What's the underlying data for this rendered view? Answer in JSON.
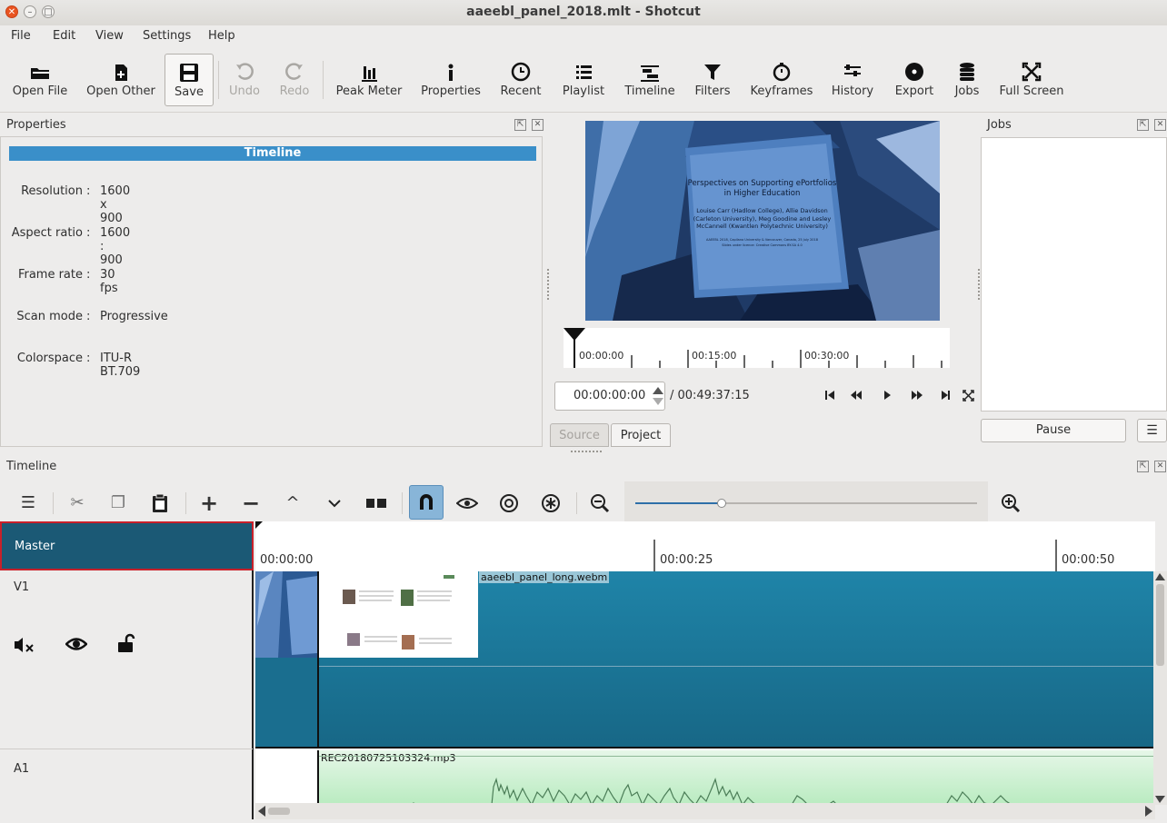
{
  "window": {
    "title": "aaeebl_panel_2018.mlt - Shotcut"
  },
  "menubar": [
    "File",
    "Edit",
    "View",
    "Settings",
    "Help"
  ],
  "toolbar": {
    "open_file": "Open File",
    "open_other": "Open Other",
    "save": "Save",
    "undo": "Undo",
    "redo": "Redo",
    "peak_meter": "Peak Meter",
    "properties": "Properties",
    "recent": "Recent",
    "playlist": "Playlist",
    "timeline": "Timeline",
    "filters": "Filters",
    "keyframes": "Keyframes",
    "history": "History",
    "export": "Export",
    "jobs": "Jobs",
    "full_screen": "Full Screen"
  },
  "properties": {
    "title": "Properties",
    "header": "Timeline",
    "rows": [
      {
        "label": "Resolution",
        "value": "1600 x 900"
      },
      {
        "label": "Aspect ratio",
        "value": "1600 : 900"
      },
      {
        "label": "Frame rate",
        "value": "30 fps"
      },
      {
        "label": "Scan mode",
        "value": "Progressive"
      },
      {
        "label": "Colorspace",
        "value": "ITU-R BT.709"
      }
    ]
  },
  "player": {
    "slide_title": "Perspectives on Supporting ePortfolios in Higher Education",
    "slide_authors": "Louise Carr (Hadlow College), Allie Davidson (Carleton University), Meg Goodine and Lesley McCannell (Kwantlen Polytechnic University)",
    "slide_footer1": "AAEEBL 2018, Capilano University & Vancouver, Canada, 25 July 2018",
    "slide_footer2": "Slides under licence: Creative Commons BY-SA 4.0",
    "ruler_ticks": [
      "00:00:00",
      "00:15:00",
      "00:30:00"
    ],
    "position": "00:00:00:00",
    "duration": "/ 00:49:37:15",
    "tab_source": "Source",
    "tab_project": "Project"
  },
  "jobs": {
    "title": "Jobs",
    "pause": "Pause",
    "menu": "☰"
  },
  "timeline": {
    "title": "Timeline",
    "ruler": [
      "00:00:00",
      "00:00:25",
      "00:00:50"
    ],
    "tracks": {
      "master": "Master",
      "v1": "V1",
      "a1": "A1"
    },
    "v1_clip": "aaeebl_panel_long.webm",
    "a1_clip": "REC20180725103324.mp3",
    "zoom_level": 0.25
  },
  "colors": {
    "accent": "#3a8fc9",
    "track": "#1a6e8f",
    "master": "#1b5975",
    "audio": "#c8efcc",
    "close": "#e95420"
  }
}
